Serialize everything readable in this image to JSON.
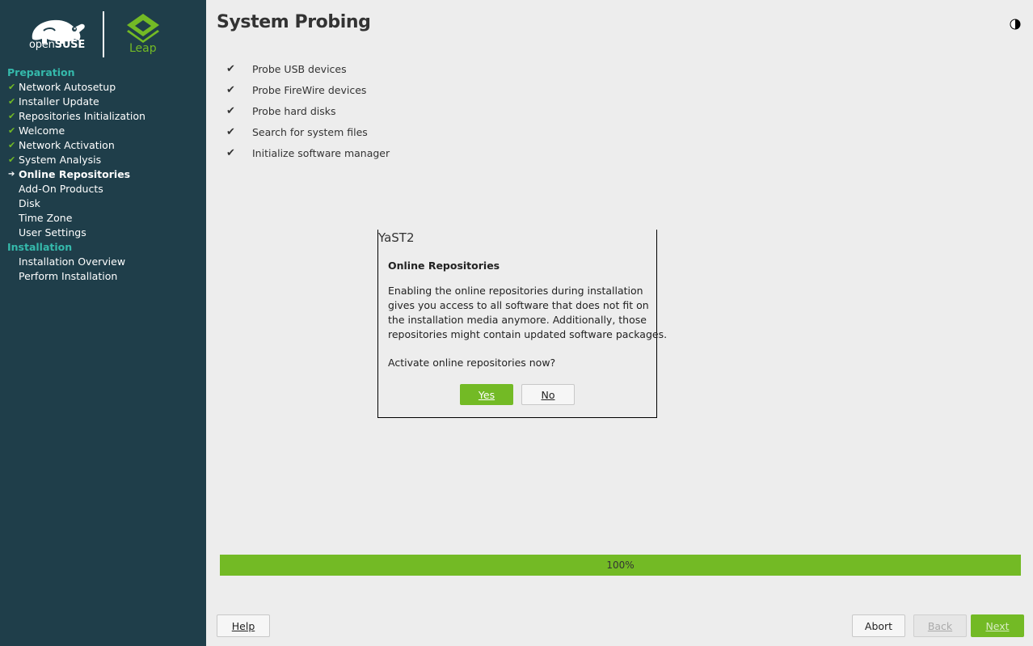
{
  "branding": {
    "distro_prefix": "open",
    "distro_name": "SUSE",
    "edition": "Leap",
    "accent_color": "#73ba25",
    "sidebar_color": "#1f3e4a"
  },
  "sidebar": {
    "sections": [
      {
        "title": "Preparation",
        "steps": [
          {
            "label": "Network Autosetup",
            "state": "done"
          },
          {
            "label": "Installer Update",
            "state": "done"
          },
          {
            "label": "Repositories Initialization",
            "state": "done"
          },
          {
            "label": "Welcome",
            "state": "done"
          },
          {
            "label": "Network Activation",
            "state": "done"
          },
          {
            "label": "System Analysis",
            "state": "done"
          },
          {
            "label": "Online Repositories",
            "state": "current"
          },
          {
            "label": "Add-On Products",
            "state": "pending"
          },
          {
            "label": "Disk",
            "state": "pending"
          },
          {
            "label": "Time Zone",
            "state": "pending"
          },
          {
            "label": "User Settings",
            "state": "pending"
          }
        ]
      },
      {
        "title": "Installation",
        "steps": [
          {
            "label": "Installation Overview",
            "state": "pending"
          },
          {
            "label": "Perform Installation",
            "state": "pending"
          }
        ]
      }
    ]
  },
  "main": {
    "title": "System Probing",
    "theme_icon": "half-moon-icon",
    "probe_items": [
      {
        "label": "Probe USB devices",
        "done": true
      },
      {
        "label": "Probe FireWire devices",
        "done": true
      },
      {
        "label": "Probe hard disks",
        "done": true
      },
      {
        "label": "Search for system files",
        "done": true
      },
      {
        "label": "Initialize software manager",
        "done": true
      }
    ],
    "check_glyph": "✔"
  },
  "dialog": {
    "window_title": "YaST2",
    "heading": "Online Repositories",
    "body_lines": [
      "Enabling the online repositories during installation",
      "gives you access to all software that does not fit on",
      "the installation media anymore. Additionally, those",
      "repositories might contain updated software packages."
    ],
    "question": "Activate online repositories now?",
    "yes_label": "Yes",
    "no_label": "No"
  },
  "progress": {
    "value_percent": 100,
    "label": "100%"
  },
  "footer": {
    "help_label": "Help",
    "abort_label": "Abort",
    "back_label": "Back",
    "next_label": "Next"
  }
}
